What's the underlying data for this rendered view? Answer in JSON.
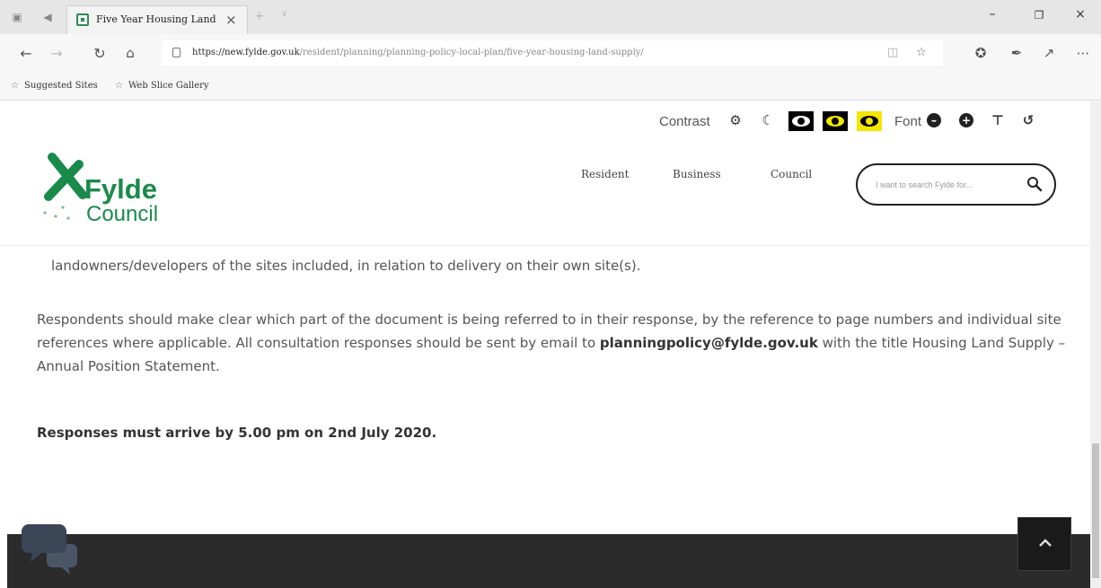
{
  "browser": {
    "tab_title": "Five Year Housing Land",
    "url_host": "https://new.fylde.gov.uk",
    "url_path": "/resident/planning/planning-policy-local-plan/five-year-housing-land-supply/",
    "favorites": [
      "Suggested Sites",
      "Web Slice Gallery"
    ]
  },
  "a11y": {
    "contrast_label": "Contrast",
    "font_label": "Font",
    "icons": [
      "gear-icon",
      "moon-icon",
      "eye-icon",
      "eye-icon",
      "eye-icon",
      "minus-icon",
      "plus-icon",
      "text-size-icon",
      "reset-icon"
    ]
  },
  "header": {
    "logo_name": "Fylde",
    "logo_sub": "Council",
    "nav": [
      "Resident",
      "Business",
      "Council"
    ],
    "search_placeholder": "I want to search Fylde for..."
  },
  "content": {
    "partial_line": "landowners/developers of the sites included, in relation to delivery on their own site(s).",
    "para_before": "Respondents should make clear which part of the document is being referred to in their response, by the reference to page numbers and individual site references where applicable. All consultation responses should be sent by email to",
    "email": "planningpolicy@fylde.gov.uk",
    "para_after": " with the title Housing Land Supply – Annual Position Statement.",
    "deadline": "Responses must arrive by 5.00 pm on 2nd July 2020."
  },
  "colors": {
    "brand_green": "#1a8a4a",
    "contrast_yellow": "#f5e600",
    "footer_bg": "#2b2b2b"
  }
}
